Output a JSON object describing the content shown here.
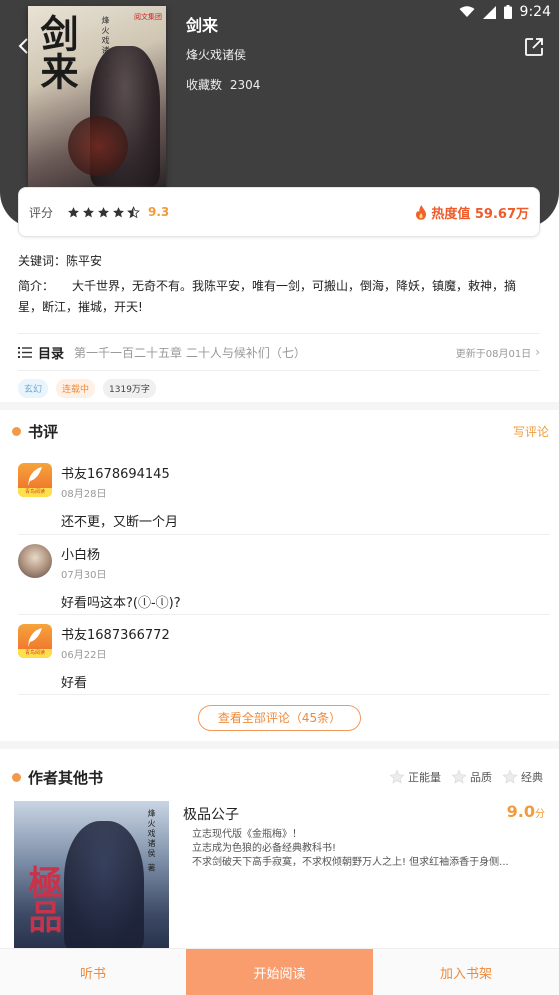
{
  "status_bar": {
    "time": "9:24"
  },
  "book": {
    "cover_title": "剑来",
    "cover_author": "烽火戏诸侯 著",
    "cover_logo": "阅文集团",
    "title": "剑来",
    "author": "烽火戏诸侯",
    "fav_label": "收藏数",
    "fav_count": "2304"
  },
  "rating": {
    "label": "评分",
    "score": "9.3",
    "stars": 4.5,
    "heat": "热度值 59.67万"
  },
  "info": {
    "keywords": "关键词：陈平安",
    "intro_label": "简介：",
    "intro_text": "大千世界，无奇不有。我陈平安，唯有一剑，可搬山，倒海，降妖，镇魔，敕神，摘星，断江，摧城，开天!"
  },
  "toc": {
    "label": "目录",
    "latest": "第一千一百二十五章 二十人与候补们（七）",
    "updated": "更新于08月01日"
  },
  "tags": [
    "玄幻",
    "连载中",
    "1319万字"
  ],
  "reviews": {
    "title": "书评",
    "write": "写评论",
    "items": [
      {
        "name": "书友1678694145",
        "date": "08月28日",
        "text": "还不更，又断一个月",
        "avatar": "app",
        "app_band": "青鸟阅读"
      },
      {
        "name": "小白杨",
        "date": "07月30日",
        "text": "好看吗这本?(ⓛ-ⓛ)?",
        "avatar": "photo"
      },
      {
        "name": "书友1687366772",
        "date": "06月22日",
        "text": "好看",
        "avatar": "app",
        "app_band": "青鸟阅读"
      }
    ],
    "view_all": "查看全部评论（45条）"
  },
  "other_books": {
    "title": "作者其他书",
    "filters": [
      "正能量",
      "品质",
      "经典"
    ],
    "book": {
      "title": "极品公子",
      "score": "9.0",
      "score_unit": "分",
      "cover_title": "極品",
      "cover_author": "烽火戏诸侯 著",
      "desc": [
        "立志现代版《金瓶梅》！",
        "立志成为色狼的必备经典教科书!",
        "不求剑破天下高手寂寞，不求权倾朝野万人之上! 但求红袖添香于身侧..."
      ]
    }
  },
  "bottom": {
    "listen": "听书",
    "read": "开始阅读",
    "add": "加入书架"
  },
  "colors": {
    "accent": "#f39a3b",
    "primary_button": "#fa9d6e",
    "header_bg": "#3f3f3f",
    "heat": "#ef5a2a"
  }
}
